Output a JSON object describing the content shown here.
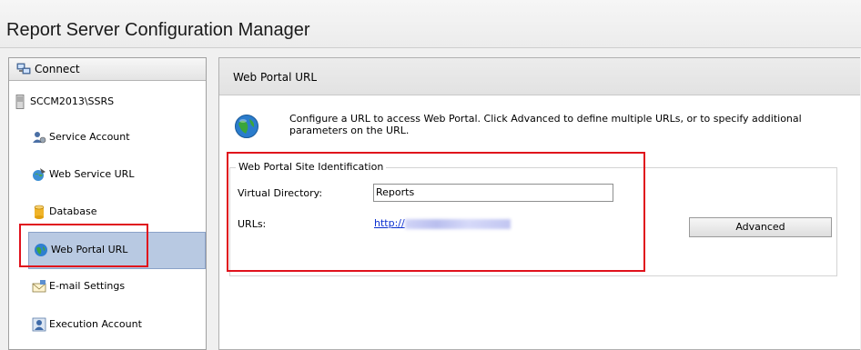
{
  "app": {
    "title": "Report Server Configuration Manager"
  },
  "sidebar": {
    "connect_label": "Connect",
    "server_name": "SCCM2013\\SSRS",
    "items": [
      {
        "label": "Service Account",
        "icon": "service-account-icon"
      },
      {
        "label": "Web Service URL",
        "icon": "web-service-icon"
      },
      {
        "label": "Database",
        "icon": "database-icon"
      },
      {
        "label": "Web Portal URL",
        "icon": "globe-icon",
        "selected": true
      },
      {
        "label": "E-mail Settings",
        "icon": "email-icon"
      },
      {
        "label": "Execution Account",
        "icon": "execution-account-icon"
      }
    ]
  },
  "main": {
    "header_title": "Web Portal URL",
    "description": "Configure a URL to access Web Portal.  Click Advanced to define multiple URLs, or to specify additional parameters on the URL.",
    "site_identification": {
      "legend": "Web Portal Site Identification",
      "virtual_directory_label": "Virtual Directory:",
      "virtual_directory_value": "Reports",
      "urls_label": "URLs:",
      "url_prefix": "http://",
      "advanced_label": "Advanced"
    }
  },
  "colors": {
    "highlight_red": "#e0121c",
    "selected_bg": "#b8c9e2",
    "link_blue": "#0b2fd0"
  }
}
